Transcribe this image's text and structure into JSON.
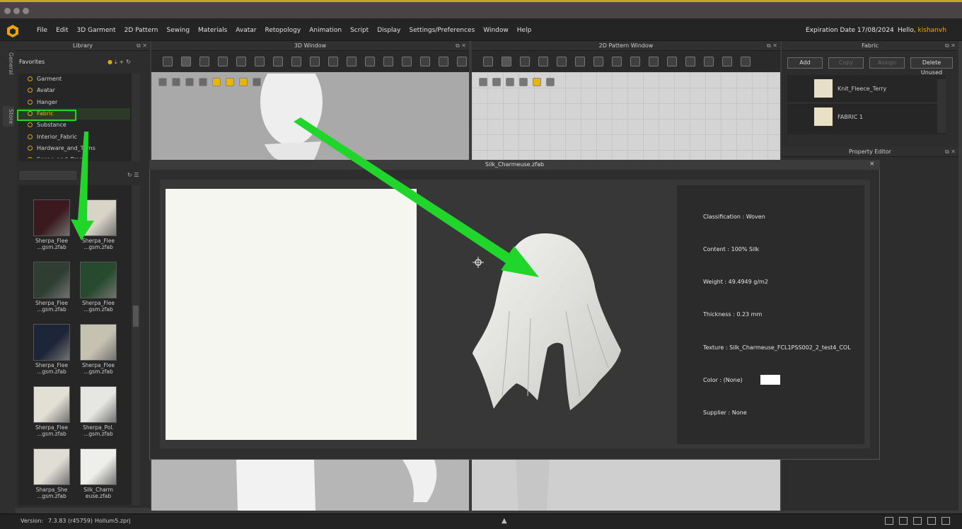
{
  "menubar": {
    "items": [
      "File",
      "Edit",
      "3D Garment",
      "2D Pattern",
      "Sewing",
      "Materials",
      "Avatar",
      "Retopology",
      "Animation",
      "Script",
      "Display",
      "Settings/Preferences",
      "Window",
      "Help"
    ],
    "expiration": "Expiration Date 17/08/2024",
    "hello_prefix": "Hello, ",
    "username": "kishanvh"
  },
  "side_tabs": [
    "General",
    "Store"
  ],
  "library": {
    "title": "Library",
    "favorites_label": "Favorites",
    "tree": [
      "Garment",
      "Avatar",
      "Hanger",
      "Fabric",
      "Substance",
      "Interior_Fabric",
      "Hardware_and_Trims",
      "Scene_and_Props"
    ],
    "selected": "Fabric",
    "thumbnails": [
      {
        "line1": "Sherpa_Flee",
        "line2": "...gsm.zfab",
        "color": "#3a1a1e"
      },
      {
        "line1": "Sherpa_Flee",
        "line2": "...gsm.zfab",
        "color": "#d8d4c8"
      },
      {
        "line1": "Sherpa_Flee",
        "line2": "...gsm.zfab",
        "color": "#2f3d33"
      },
      {
        "line1": "Sherpa_Flee",
        "line2": "...gsm.zfab",
        "color": "#274a2e"
      },
      {
        "line1": "Sherpa_Flee",
        "line2": "...gsm.zfab",
        "color": "#1d2638"
      },
      {
        "line1": "Sherpa_Flee",
        "line2": "...gsm.zfab",
        "color": "#c6c2b2"
      },
      {
        "line1": "Sherpa_Flee",
        "line2": "...gsm.zfab",
        "color": "#e2e0d4"
      },
      {
        "line1": "Sherpa_Pol.",
        "line2": "...gsm.zfab",
        "color": "#e6e6e2"
      },
      {
        "line1": "Sharpa_She",
        "line2": "...gsm.zfab",
        "color": "#e0ded4"
      },
      {
        "line1": "Silk_Charm",
        "line2": "euse.zfab",
        "color": "#eeeeea"
      }
    ]
  },
  "window3d": {
    "title": "3D Window"
  },
  "window2d": {
    "title": "2D Pattern Window"
  },
  "fabric_panel": {
    "title": "Fabric",
    "buttons": [
      "Add",
      "Copy",
      "Assign",
      "Delete Unused"
    ],
    "items": [
      {
        "name": "Knit_Fleece_Terry",
        "swatch": "#e8dfc8"
      },
      {
        "name": "FABRIC 1",
        "swatch": "#e9e0c6"
      }
    ]
  },
  "property_editor": {
    "title": "Property Editor"
  },
  "popup": {
    "title": "Silk_Charmeuse.zfab",
    "close": "×",
    "info": [
      {
        "label": "Classification : ",
        "value": "Woven"
      },
      {
        "label": "Content : ",
        "value": "100% Silk"
      },
      {
        "label": "Weight : ",
        "value": "49.4949 g/m2"
      },
      {
        "label": "Thickness : ",
        "value": "0.23 mm"
      },
      {
        "label": "Texture : ",
        "value": "Silk_Charmeuse_FCL1PSS002_2_test4_COL"
      },
      {
        "label": "Color : ",
        "value": "(None)"
      },
      {
        "label": "Supplier : ",
        "value": "None"
      }
    ],
    "color_swatch": "#ffffff"
  },
  "statusbar": {
    "version_label": "Version:",
    "version": "7.3.83 (r45759)",
    "file": "Hollum5.zprj"
  },
  "colors": {
    "accent": "#f0b400",
    "highlight": "#2bd42b"
  }
}
